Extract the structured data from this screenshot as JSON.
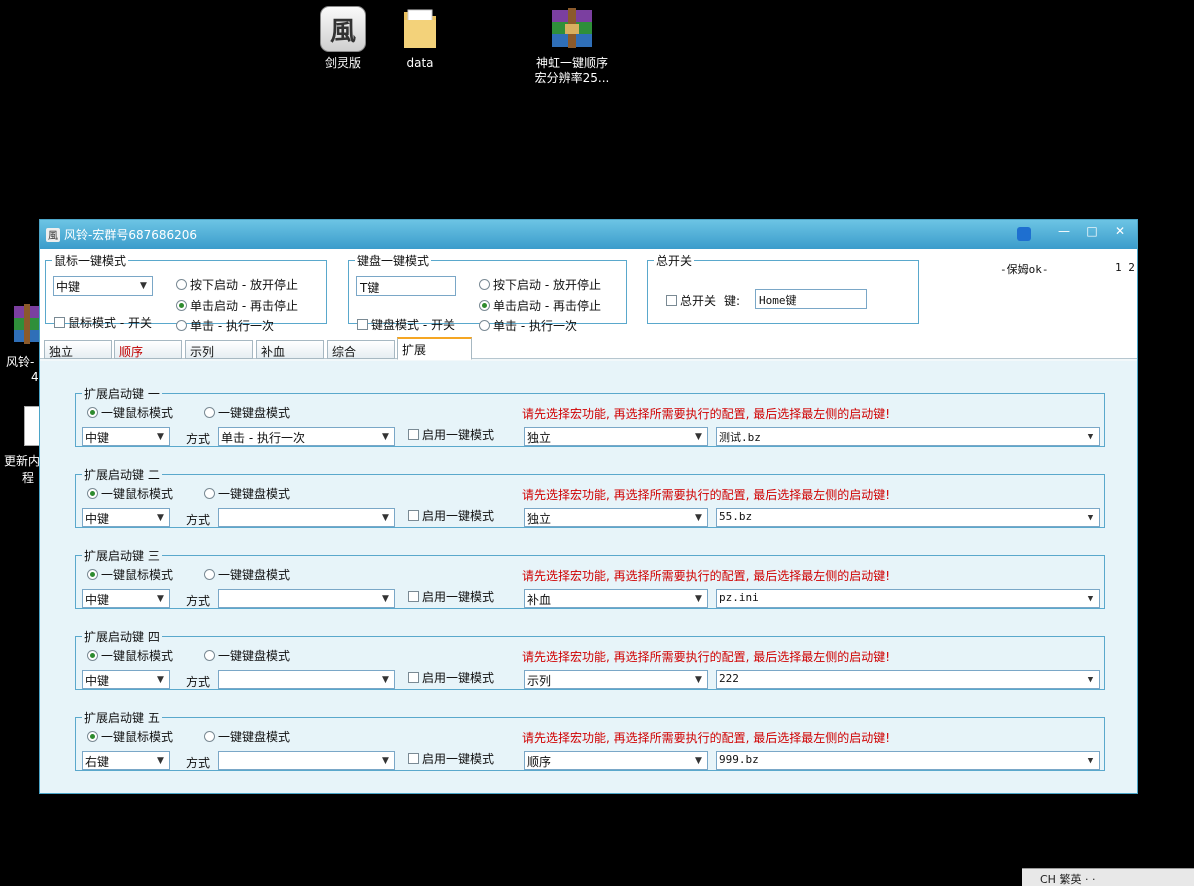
{
  "desktop": {
    "icons": [
      {
        "label": "剑灵版",
        "icon": "feng-app-icon"
      },
      {
        "label": "data",
        "icon": "folder-icon"
      },
      {
        "label": "神虹一键顺序\n宏分辨率25...",
        "icon": "winrar-archive-icon"
      }
    ],
    "partial_left": [
      "风铃-",
      "4",
      "更新内",
      "程"
    ],
    "taskbar_text": "CH 繁英 · ·"
  },
  "window": {
    "title": "风铃-宏群号687686206",
    "app_icon_char": "風",
    "controls": {
      "minimize": "—",
      "maximize": "□",
      "close": "✕"
    }
  },
  "mouse_mode": {
    "legend": "鼠标一键模式",
    "key_select": "中键",
    "toggle_label": "鼠标模式 - 开关",
    "toggle_checked": false,
    "options": [
      "按下启动 - 放开停止",
      "单击启动 - 再击停止",
      "单击 - 执行一次"
    ],
    "selected_option": 1
  },
  "keyboard_mode": {
    "legend": "键盘一键模式",
    "key_input": "T键",
    "toggle_label": "键盘模式 - 开关",
    "toggle_checked": false,
    "options": [
      "按下启动 - 放开停止",
      "单击启动 - 再击停止",
      "单击 - 执行一次"
    ],
    "selected_option": 1
  },
  "master_switch": {
    "legend": "总开关",
    "checkbox_label": "总开关",
    "key_label": "键:",
    "key_input": "Home键",
    "checked": false
  },
  "status": {
    "text": "-保姆ok-",
    "numbers": "1 2"
  },
  "tabs": [
    "独立",
    "顺序",
    "示列",
    "补血",
    "综合",
    "扩展"
  ],
  "active_tab": 5,
  "extensions": [
    {
      "legend": "扩展启动键 一",
      "mode_mouse": "一键鼠标模式",
      "mode_keyboard": "一键键盘模式",
      "mouse_selected": true,
      "key": "中键",
      "method_label": "方式",
      "method": "单击 - 执行一次",
      "enable_label": "启用一键模式",
      "enabled": false,
      "warning": "请先选择宏功能, 再选择所需要执行的配置, 最后选择最左侧的启动键!",
      "function": "独立",
      "config": "测试.bz"
    },
    {
      "legend": "扩展启动键 二",
      "mode_mouse": "一键鼠标模式",
      "mode_keyboard": "一键键盘模式",
      "mouse_selected": true,
      "key": "中键",
      "method_label": "方式",
      "method": "",
      "enable_label": "启用一键模式",
      "enabled": false,
      "warning": "请先选择宏功能, 再选择所需要执行的配置, 最后选择最左侧的启动键!",
      "function": "独立",
      "config": "55.bz"
    },
    {
      "legend": "扩展启动键 三",
      "mode_mouse": "一键鼠标模式",
      "mode_keyboard": "一键键盘模式",
      "mouse_selected": true,
      "key": "中键",
      "method_label": "方式",
      "method": "",
      "enable_label": "启用一键模式",
      "enabled": false,
      "warning": "请先选择宏功能, 再选择所需要执行的配置, 最后选择最左侧的启动键!",
      "function": "补血",
      "config": "pz.ini"
    },
    {
      "legend": "扩展启动键 四",
      "mode_mouse": "一键鼠标模式",
      "mode_keyboard": "一键键盘模式",
      "mouse_selected": true,
      "key": "中键",
      "method_label": "方式",
      "method": "",
      "enable_label": "启用一键模式",
      "enabled": false,
      "warning": "请先选择宏功能, 再选择所需要执行的配置, 最后选择最左侧的启动键!",
      "function": "示列",
      "config": "222"
    },
    {
      "legend": "扩展启动键 五",
      "mode_mouse": "一键鼠标模式",
      "mode_keyboard": "一键键盘模式",
      "mouse_selected": true,
      "key": "右键",
      "method_label": "方式",
      "method": "",
      "enable_label": "启用一键模式",
      "enabled": false,
      "warning": "请先选择宏功能, 再选择所需要执行的配置, 最后选择最左侧的启动键!",
      "function": "顺序",
      "config": "999.bz"
    }
  ]
}
